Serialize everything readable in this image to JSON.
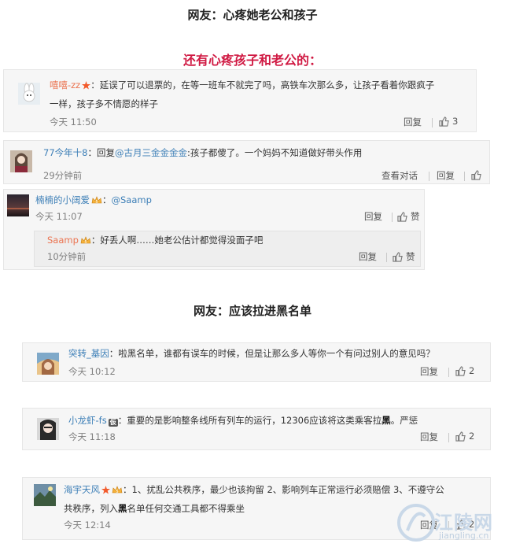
{
  "headings": {
    "h1": "网友：心疼她老公和孩子",
    "h2": "还有心疼孩子和老公的：",
    "h3": "网友：应该拉进黑名单"
  },
  "comments": [
    {
      "user": "嘻嘻-zz",
      "text_1": "：延误了可以退票的，在等一班车不就完了吗，高铁车次那么多，让孩子看着你跟疯子",
      "text_2": "一样，孩子多不情愿的样子",
      "time": "今天 11:50",
      "reply": "回复",
      "likes": "3"
    },
    {
      "user": "77今年十8",
      "text_pre": "：回复",
      "mention": "@古月三金金金金",
      "text_post": ":孩子都傻了。一个妈妈不知道做好带头作用",
      "time": "29分钟前",
      "view_thread": "查看对话",
      "reply": "回复"
    },
    {
      "user": "楠楠的小阔爱",
      "mention_prefix": "：",
      "mention": "@Saamp",
      "time": "今天 11:07",
      "reply": "回复",
      "like": "赞",
      "nested": {
        "user": "Saamp",
        "text": "：好丢人啊……她老公估计都觉得没面子吧",
        "time": "10分钟前",
        "reply": "回复",
        "like": "赞"
      }
    },
    {
      "user": "突转_基因",
      "text_pre": "：啦",
      "text_hl": "黑",
      "text_post": "名单，谁都有误车的时候，但是让那么多人等你一个有问过别人的意见吗？",
      "time": "今天 10:12",
      "reply": "回复",
      "likes": "2"
    },
    {
      "user": "小龙虾-fs",
      "text_pre": "：重要的是影响整条线所有列车的运行，12306应该将这类乘客拉",
      "text_hl": "黑",
      "text_post": "。严惩",
      "time": "今天 11:18",
      "reply": "回复",
      "likes": "2"
    },
    {
      "user": "海宇天风",
      "text_1": "：1、扰乱公共秩序，最少也该拘留 2、影响列车正常运行必须赔偿 3、不遵守公",
      "text_2_pre": "共秩序，列入",
      "text_2_hl": "黑",
      "text_2_post": "名单任何交通工具都不得乘坐",
      "time": "今天 12:14",
      "reply": "回复",
      "likes": "2"
    }
  ],
  "watermark": {
    "cn": "江陵网",
    "en": "jiangling.cn"
  },
  "colors": {
    "accent_red": "#d01a43",
    "username_orange": "#eb7350",
    "username_blue": "#3d7fb7"
  }
}
